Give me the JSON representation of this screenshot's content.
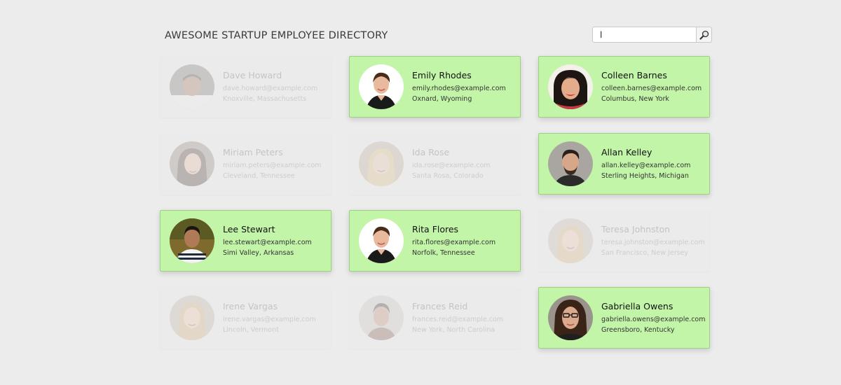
{
  "header": {
    "title": "AWESOME STARTUP EMPLOYEE DIRECTORY"
  },
  "search": {
    "value": "l",
    "placeholder": "",
    "button_icon": "search-icon"
  },
  "employees": [
    {
      "name": "Dave Howard",
      "email": "dave.howard@example.com",
      "location": "Knoxville, Massachusetts",
      "match": false
    },
    {
      "name": "Emily Rhodes",
      "email": "emily.rhodes@example.com",
      "location": "Oxnard, Wyoming",
      "match": true
    },
    {
      "name": "Colleen Barnes",
      "email": "colleen.barnes@example.com",
      "location": "Columbus, New York",
      "match": true
    },
    {
      "name": "Miriam Peters",
      "email": "miriam.peters@example.com",
      "location": "Cleveland, Tennessee",
      "match": false
    },
    {
      "name": "Ida Rose",
      "email": "ida.rose@example.com",
      "location": "Santa Rosa, Colorado",
      "match": false
    },
    {
      "name": "Allan Kelley",
      "email": "allan.kelley@example.com",
      "location": "Sterling Heights, Michigan",
      "match": true
    },
    {
      "name": "Lee Stewart",
      "email": "lee.stewart@example.com",
      "location": "Simi Valley, Arkansas",
      "match": true
    },
    {
      "name": "Rita Flores",
      "email": "rita.flores@example.com",
      "location": "Norfolk, Tennessee",
      "match": true
    },
    {
      "name": "Teresa Johnston",
      "email": "teresa.johnston@example.com",
      "location": "San Francisco, New Jersey",
      "match": false
    },
    {
      "name": "Irene Vargas",
      "email": "irene.vargas@example.com",
      "location": "Lincoln, Vermont",
      "match": false
    },
    {
      "name": "Frances Reid",
      "email": "frances.reid@example.com",
      "location": "New York, North Carolina",
      "match": false
    },
    {
      "name": "Gabriella Owens",
      "email": "gabriella.owens@example.com",
      "location": "Greensboro, Kentucky",
      "match": true
    }
  ],
  "colors": {
    "match_background": "#c3f5a8",
    "dim_background": "#ebebeb",
    "page_background": "#ececec"
  }
}
